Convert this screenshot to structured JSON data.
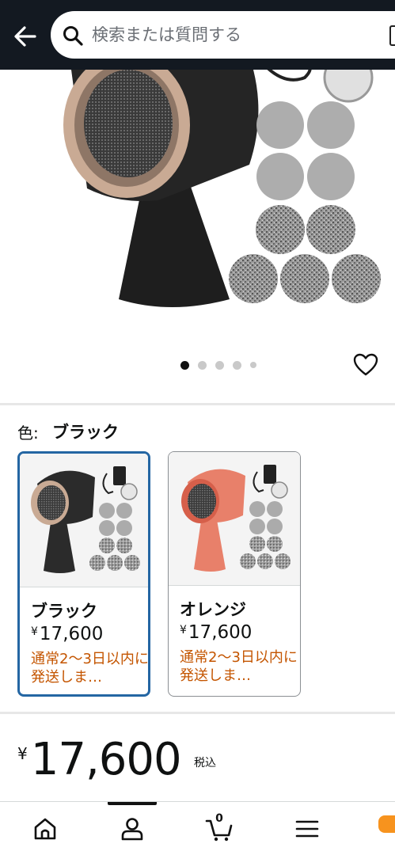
{
  "header": {
    "search_placeholder": "検索または質問する",
    "icons": {
      "back": "arrow-left-icon",
      "search": "magnifier-icon",
      "scan": "camera-scan-icon"
    }
  },
  "gallery": {
    "image_count": 5,
    "active_index": 0
  },
  "color_selector": {
    "label": "色:",
    "selected_value": "ブラック",
    "options": [
      {
        "name": "ブラック",
        "yen": "¥",
        "price": "17,600",
        "shipping": "通常2〜3日以内に発送しま…",
        "selected": true,
        "product_color": "#2b2b2b"
      },
      {
        "name": "オレンジ",
        "yen": "¥",
        "price": "17,600",
        "shipping": "通常2〜3日以内に発送しま…",
        "selected": false,
        "product_color": "#e8806a"
      }
    ]
  },
  "price": {
    "yen": "¥",
    "amount": "17,600",
    "tax_note": "税込"
  },
  "bottom_nav": {
    "cart_count": "0",
    "icons": [
      "home-icon",
      "account-icon",
      "cart-icon",
      "menu-icon"
    ]
  },
  "colors": {
    "header_bg": "#131921",
    "selected_border": "#2466a3",
    "shipping_text": "#c45500",
    "accent": "#f7931e"
  }
}
